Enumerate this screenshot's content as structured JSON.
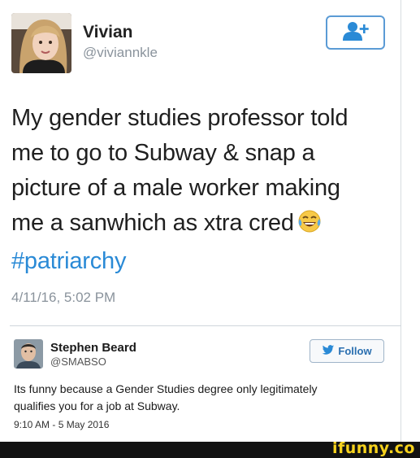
{
  "tweet1": {
    "author_name": "Vivian",
    "author_handle": "@viviannkle",
    "text_lines": [
      "My gender studies professor told",
      "me to go to Subway & snap a",
      "picture of a male worker making",
      "me a sanwhich as xtra cred"
    ],
    "hashtag": "#patriarchy",
    "emoji_icon": "laughing-crying-face",
    "timestamp": "4/11/16, 5:02 PM",
    "follow_icon": "add-user-icon"
  },
  "tweet2": {
    "author_name": "Stephen Beard",
    "author_handle": "@SMABSO",
    "follow_label": "Follow",
    "text_lines": [
      "Its funny because a Gender Studies degree only legitimately",
      "qualifies you for a job at Subway."
    ],
    "timestamp": "9:10 AM - 5 May 2016"
  },
  "watermark": {
    "text": "ifunny.co"
  },
  "colors": {
    "accent": "#2a8ad6",
    "follow_border": "#5b9bd5",
    "muted": "#8a939c",
    "watermark": "#f6d21d"
  }
}
